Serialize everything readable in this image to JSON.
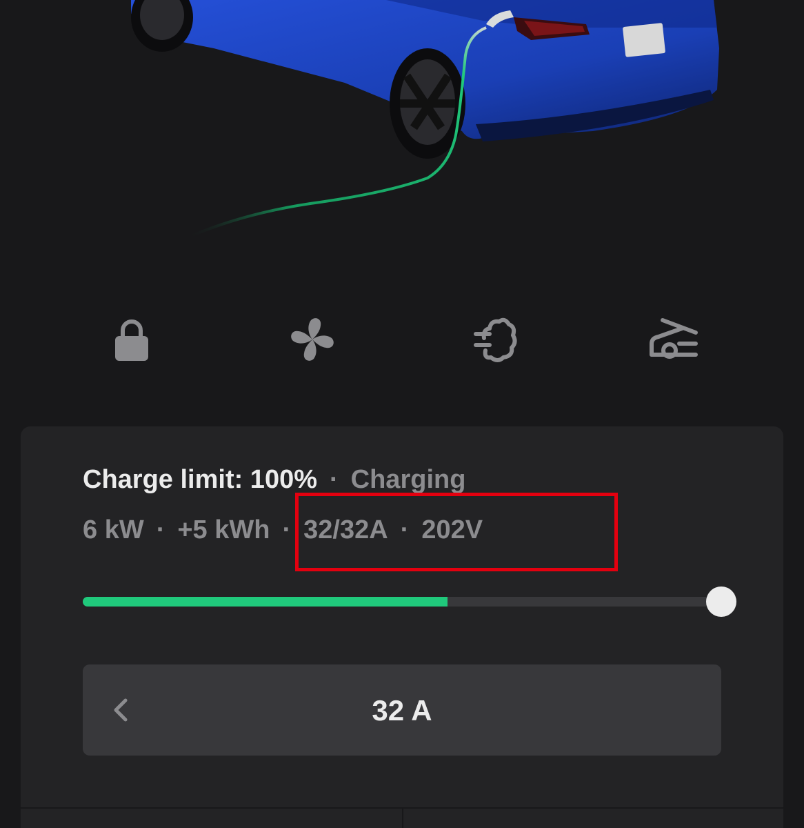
{
  "car": {
    "icon": "car-charging-illustration",
    "body_color": "#1a3fb5",
    "cable_color": "#20c97c"
  },
  "quick_controls": [
    {
      "name": "lock",
      "icon": "lock-icon"
    },
    {
      "name": "climate",
      "icon": "fan-icon"
    },
    {
      "name": "charge-port",
      "icon": "charge-port-icon"
    },
    {
      "name": "frunk",
      "icon": "frunk-icon"
    }
  ],
  "charging": {
    "limit_label": "Charge limit: 100%",
    "separator": "·",
    "state": "Charging",
    "power": "6 kW",
    "energy_added": "+5 kWh",
    "current": "32/32A",
    "voltage": "202V",
    "charge_level_fraction": 0.57,
    "charge_limit_fraction": 1.0,
    "amps_setting": "32 A"
  },
  "colors": {
    "background": "#18181a",
    "card": "#232325",
    "accent_green": "#20c97c",
    "highlight_red": "#e3000f",
    "muted_text": "#8c8c8f",
    "primary_text": "#ececec"
  }
}
